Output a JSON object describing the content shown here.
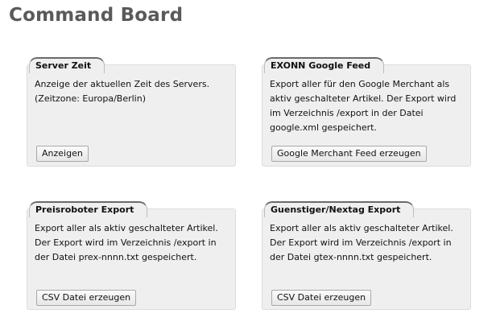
{
  "page": {
    "title": "Command Board"
  },
  "cards": [
    {
      "title": "Server Zeit",
      "description": "Anzeige der aktuellen Zeit des Servers. (Zeitzone: Europa/Berlin)",
      "button_label": "Anzeigen"
    },
    {
      "title": "EXONN Google Feed",
      "description": "Export aller für den Google Merchant als aktiv geschalteter Artikel. Der Export wird im Verzeichnis /export in der Datei google.xml gespeichert.",
      "button_label": "Google Merchant Feed erzeugen"
    },
    {
      "title": "Preisroboter Export",
      "description": "Export aller als aktiv geschalteter Artikel. Der Export wird im Verzeichnis /export in der Datei prex-nnnn.txt gespeichert.",
      "button_label": "CSV Datei erzeugen"
    },
    {
      "title": "Guenstiger/Nextag Export",
      "description": "Export aller als aktiv geschalteter Artikel. Der Export wird im Verzeichnis /export in der Datei gtex-nnnn.txt gespeichert.",
      "button_label": "CSV Datei erzeugen"
    }
  ]
}
